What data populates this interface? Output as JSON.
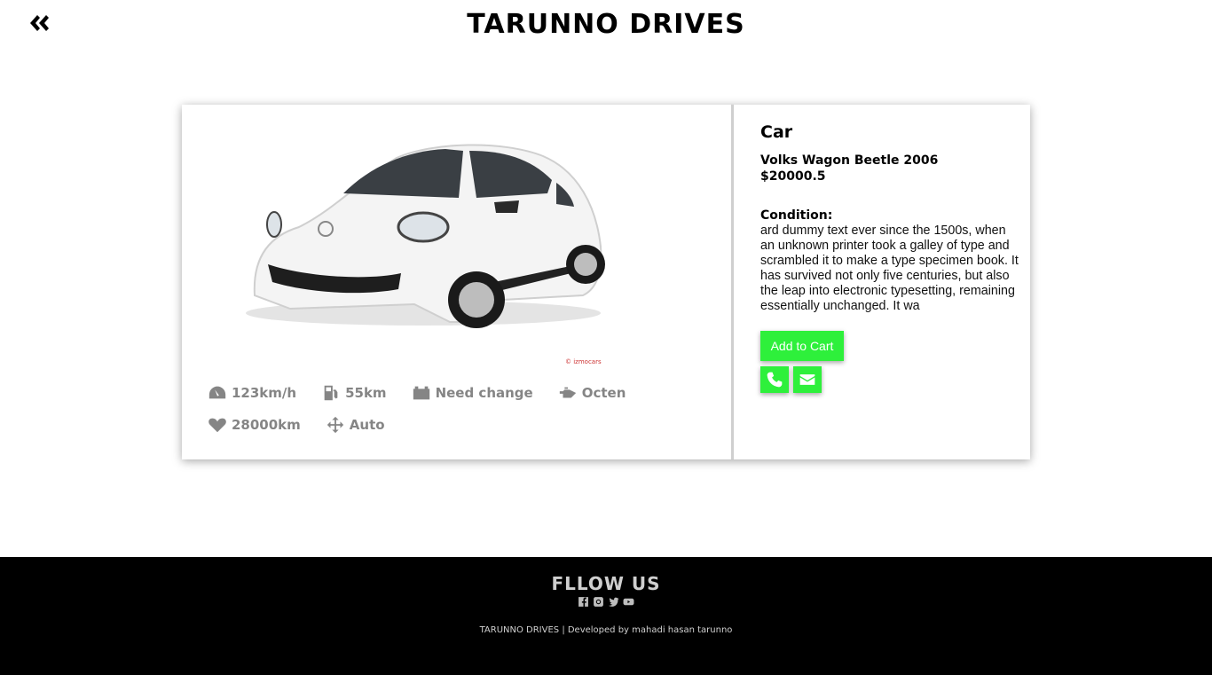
{
  "header": {
    "title": "TARUNNO DRIVES",
    "back_icon": "double-chevron-left-icon"
  },
  "product": {
    "category": "Car",
    "name": "Volks Wagon Beetle 2006",
    "price": "$20000.5",
    "condition_label": "Condition:",
    "condition_text": "ard dummy text ever since the 1500s, when an unknown printer took a galley of type and scrambled it to make a type specimen book. It has survived not only five centuries, but also the leap into electronic typesetting, remaining essentially unchanged. It wa",
    "image_watermark": "© izmocars",
    "specs": [
      {
        "icon": "speedometer-icon",
        "value": "123km/h"
      },
      {
        "icon": "fuel-pump-icon",
        "value": "55km"
      },
      {
        "icon": "battery-icon",
        "value": "Need change"
      },
      {
        "icon": "oil-can-icon",
        "value": "Octen"
      },
      {
        "icon": "heartbeat-icon",
        "value": "28000km"
      },
      {
        "icon": "arrows-move-icon",
        "value": "Auto"
      }
    ],
    "add_to_cart_label": "Add to Cart",
    "phone_icon": "phone-icon",
    "email_icon": "envelope-icon"
  },
  "footer": {
    "follow_title": "FLLOW US",
    "social_icons": [
      "facebook-icon",
      "instagram-icon",
      "twitter-icon",
      "youtube-icon"
    ],
    "credits": "TARUNNO DRIVES | Developed by mahadi hasan tarunno"
  },
  "colors": {
    "accent": "#2ef03b",
    "footer_bg": "#000000",
    "spec_text": "#858585"
  }
}
